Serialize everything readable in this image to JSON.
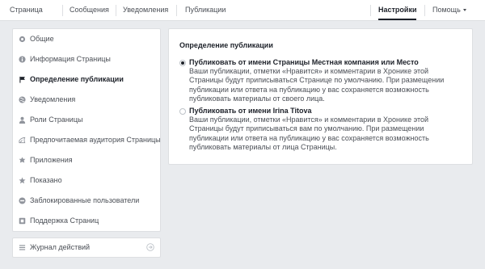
{
  "topnav": {
    "items": [
      "Страница",
      "Сообщения",
      "Уведомления",
      "Публикации"
    ],
    "settings": "Настройки",
    "help": "Помощь"
  },
  "sidebar": {
    "items": [
      {
        "label": "Общие",
        "icon": "gear-icon"
      },
      {
        "label": "Информация Страницы",
        "icon": "info-icon"
      },
      {
        "label": "Определение публикации",
        "icon": "flag-icon"
      },
      {
        "label": "Уведомления",
        "icon": "globe-icon"
      },
      {
        "label": "Роли Страницы",
        "icon": "person-icon"
      },
      {
        "label": "Предпочитаемая аудитория Страницы",
        "icon": "audience-icon"
      },
      {
        "label": "Приложения",
        "icon": "apps-icon"
      },
      {
        "label": "Показано",
        "icon": "star-icon"
      },
      {
        "label": "Заблокированные пользователи",
        "icon": "block-icon"
      },
      {
        "label": "Поддержка Страниц",
        "icon": "support-icon"
      }
    ],
    "active_index": 2,
    "journal": "Журнал действий"
  },
  "panel": {
    "title": "Определение публикации",
    "options": [
      {
        "title": "Публиковать от имени Страницы Местная компания или Место",
        "desc": "Ваши публикации, отметки «Нравится» и комментарии в Хронике этой Страницы будут приписываться Странице по умолчанию. При размещении публикации или ответа на публикацию у вас сохраняется возможность публиковать материалы от своего лица.",
        "checked": true
      },
      {
        "title": "Публиковать от имени Irina Titova",
        "desc": "Ваши публикации, отметки «Нравится» и комментарии в Хронике этой Страницы будут приписываться вам по умолчанию. При размещении публикации или ответа на публикацию у вас сохраняется возможность публиковать материалы от лица Страницы.",
        "checked": false
      }
    ]
  }
}
